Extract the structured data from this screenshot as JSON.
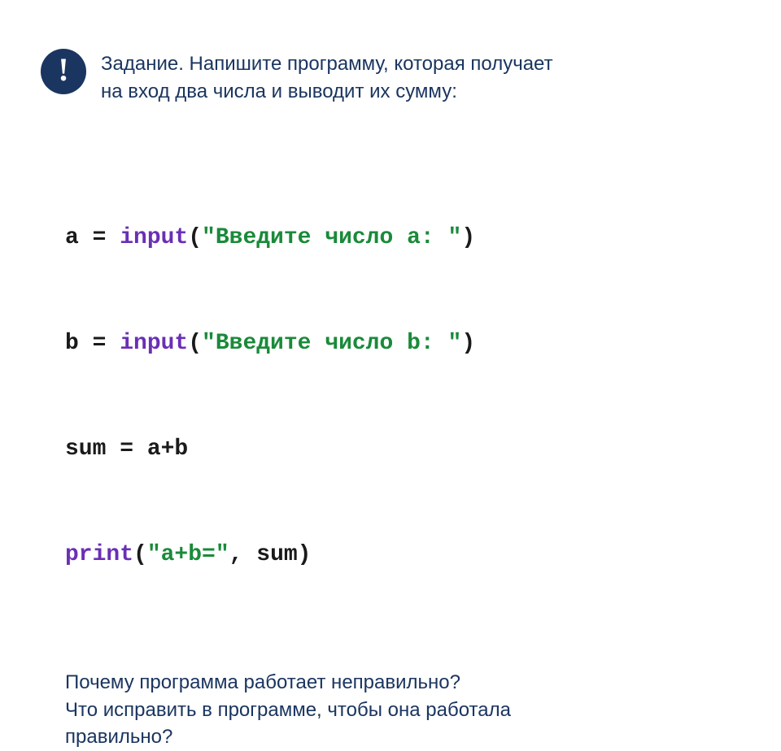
{
  "header": {
    "exclaim": "!",
    "task_line1": "Задание. Напишите программу, которая получает",
    "task_line2": "на вход два числа и выводит их сумму:"
  },
  "code": {
    "line1": {
      "pre": "a = ",
      "func": "input",
      "open": "(",
      "str": "\"Введите число a: \"",
      "close": ")"
    },
    "line2": {
      "pre": "b = ",
      "func": "input",
      "open": "(",
      "str": "\"Введите число b: \"",
      "close": ")"
    },
    "line3": {
      "text": "sum = a+b"
    },
    "line4": {
      "func": "print",
      "open": "(",
      "str": "\"a+b=\"",
      "mid": ", sum",
      "close": ")"
    }
  },
  "questions": {
    "q1": "Почему программа работает неправильно?",
    "q2": "Что исправить в программе, чтобы она работала",
    "q3": "правильно?"
  }
}
